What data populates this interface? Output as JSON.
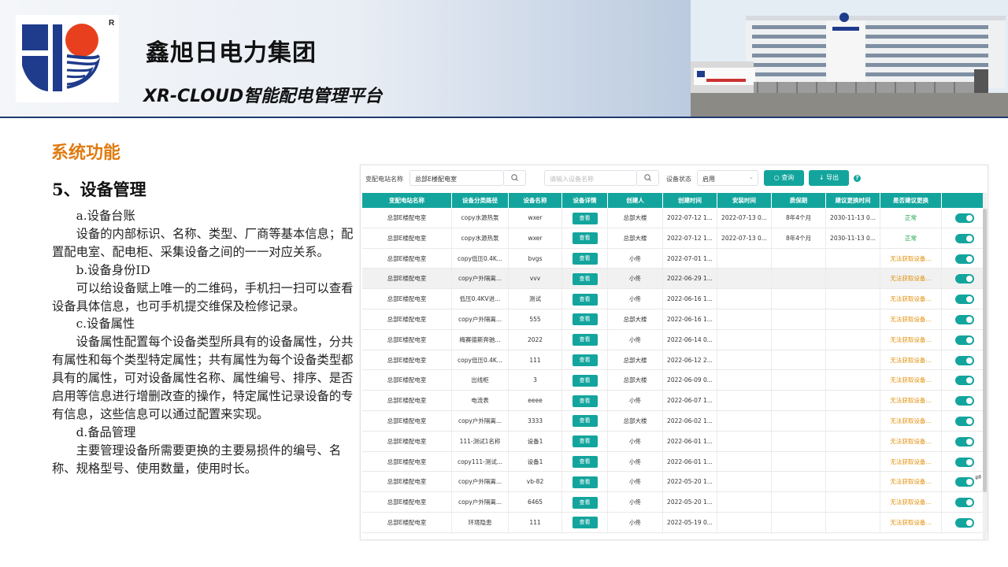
{
  "header": {
    "company": "鑫旭日电力集团",
    "platform": "XR-CLOUD智能配电管理平台",
    "logo_mark": "R",
    "colors": {
      "logo_blue": "#1f3b8c",
      "logo_red": "#e8401e",
      "accent": "#13a59d",
      "section_orange": "#e07b10"
    }
  },
  "content": {
    "section_title": "系统功能",
    "sub_title": "5、设备管理",
    "paragraphs": [
      "a.设备台账",
      "设备的内部标识、名称、类型、厂商等基本信息；配置配电室、配电柜、采集设备之间的一一对应关系。",
      "b.设备身份ID",
      "可以给设备赋上唯一的二维码，手机扫一扫可以查看设备具体信息，也可手机提交维保及检修记录。",
      "c.设备属性",
      "设备属性配置每个设备类型所具有的设备属性，分共有属性和每个类型特定属性；共有属性为每个设备类型都具有的属性，可对设备属性名称、属性编号、排序、是否启用等信息进行增删改查的操作，特定属性记录设备的专有信息，这些信息可以通过配置来实现。",
      "d.备品管理",
      "主要管理设备所需要更换的主要易损件的编号、名称、规格型号、使用数量，使用时长。"
    ]
  },
  "app": {
    "toolbar": {
      "station_label": "变配电站名称",
      "station_value": "总部E楼配电室",
      "device_placeholder": "请输入设备名称",
      "status_label": "设备状态",
      "status_value": "启用",
      "query_label": "查询",
      "export_label": "导出",
      "help_glyph": "?"
    },
    "columns": [
      "变配电站名称",
      "设备分类路径",
      "设备名称",
      "设备详情",
      "创建人",
      "创建时间",
      "安装时间",
      "质保期",
      "建议更换时间",
      "是否建议更换",
      ""
    ],
    "view_label": "查看",
    "rows": [
      {
        "station": "总部E楼配电室",
        "path": "copy水源热泵",
        "name": "wxer",
        "creator": "总部大楼",
        "created": "2022-07-12 1...",
        "installed": "2022-07-13 0...",
        "warranty": "8年4个月",
        "replace": "2030-11-13 0...",
        "advice": "正常",
        "advice_type": "ok"
      },
      {
        "station": "总部E楼配电室",
        "path": "copy水源热泵",
        "name": "wxer",
        "creator": "总部大楼",
        "created": "2022-07-12 1...",
        "installed": "2022-07-13 0...",
        "warranty": "8年4个月",
        "replace": "2030-11-13 0...",
        "advice": "正常",
        "advice_type": "ok"
      },
      {
        "station": "总部E楼配电室",
        "path": "copy低压0.4K...",
        "name": "bvgs",
        "creator": "小佟",
        "created": "2022-07-01 1...",
        "installed": "",
        "warranty": "",
        "replace": "",
        "advice": "无法获取设备...",
        "advice_type": "warn"
      },
      {
        "station": "总部E楼配电室",
        "path": "copy户外隔离...",
        "name": "vvv",
        "creator": "小佟",
        "created": "2022-06-29 1...",
        "installed": "",
        "warranty": "",
        "replace": "",
        "advice": "无法获取设备...",
        "advice_type": "warn"
      },
      {
        "station": "总部E楼配电室",
        "path": "低压0.4KV进...",
        "name": "测试",
        "creator": "小佟",
        "created": "2022-06-16 1...",
        "installed": "",
        "warranty": "",
        "replace": "",
        "advice": "无法获取设备...",
        "advice_type": "warn"
      },
      {
        "station": "总部E楼配电室",
        "path": "copy户外隔离...",
        "name": "555",
        "creator": "总部大楼",
        "created": "2022-06-16 1...",
        "installed": "",
        "warranty": "",
        "replace": "",
        "advice": "无法获取设备...",
        "advice_type": "warn"
      },
      {
        "station": "总部E楼配电室",
        "path": "梅赛德斯奔驰...",
        "name": "2022",
        "creator": "小佟",
        "created": "2022-06-14 0...",
        "installed": "",
        "warranty": "",
        "replace": "",
        "advice": "无法获取设备...",
        "advice_type": "warn"
      },
      {
        "station": "总部E楼配电室",
        "path": "copy低压0.4K...",
        "name": "111",
        "creator": "总部大楼",
        "created": "2022-06-12 2...",
        "installed": "",
        "warranty": "",
        "replace": "",
        "advice": "无法获取设备...",
        "advice_type": "warn"
      },
      {
        "station": "总部E楼配电室",
        "path": "出线柜",
        "name": "3",
        "creator": "总部大楼",
        "created": "2022-06-09 0...",
        "installed": "",
        "warranty": "",
        "replace": "",
        "advice": "无法获取设备...",
        "advice_type": "warn"
      },
      {
        "station": "总部E楼配电室",
        "path": "电流表",
        "name": "eeee",
        "creator": "小佟",
        "created": "2022-06-07 1...",
        "installed": "",
        "warranty": "",
        "replace": "",
        "advice": "无法获取设备...",
        "advice_type": "warn"
      },
      {
        "station": "总部E楼配电室",
        "path": "copy户外隔离...",
        "name": "3333",
        "creator": "总部大楼",
        "created": "2022-06-02 1...",
        "installed": "",
        "warranty": "",
        "replace": "",
        "advice": "无法获取设备...",
        "advice_type": "warn"
      },
      {
        "station": "总部E楼配电室",
        "path": "111-测试1名称",
        "name": "设备1",
        "creator": "小佟",
        "created": "2022-06-01 1...",
        "installed": "",
        "warranty": "",
        "replace": "",
        "advice": "无法获取设备...",
        "advice_type": "warn"
      },
      {
        "station": "总部E楼配电室",
        "path": "copy111-测试...",
        "name": "设备1",
        "creator": "小佟",
        "created": "2022-06-01 1...",
        "installed": "",
        "warranty": "",
        "replace": "",
        "advice": "无法获取设备...",
        "advice_type": "warn"
      },
      {
        "station": "总部E楼配电室",
        "path": "copy户外隔离...",
        "name": "vb-82",
        "creator": "小佟",
        "created": "2022-05-20 1...",
        "installed": "",
        "warranty": "",
        "replace": "",
        "advice": "无法获取设备...",
        "advice_type": "warn"
      },
      {
        "station": "总部E楼配电室",
        "path": "copy户外隔离...",
        "name": "6465",
        "creator": "小佟",
        "created": "2022-05-20 1...",
        "installed": "",
        "warranty": "",
        "replace": "",
        "advice": "无法获取设备...",
        "advice_type": "warn"
      },
      {
        "station": "总部E楼配电室",
        "path": "环境隐患",
        "name": "111",
        "creator": "小佟",
        "created": "2022-05-19 0...",
        "installed": "",
        "warranty": "",
        "replace": "",
        "advice": "无法获取设备...",
        "advice_type": "warn"
      }
    ]
  }
}
